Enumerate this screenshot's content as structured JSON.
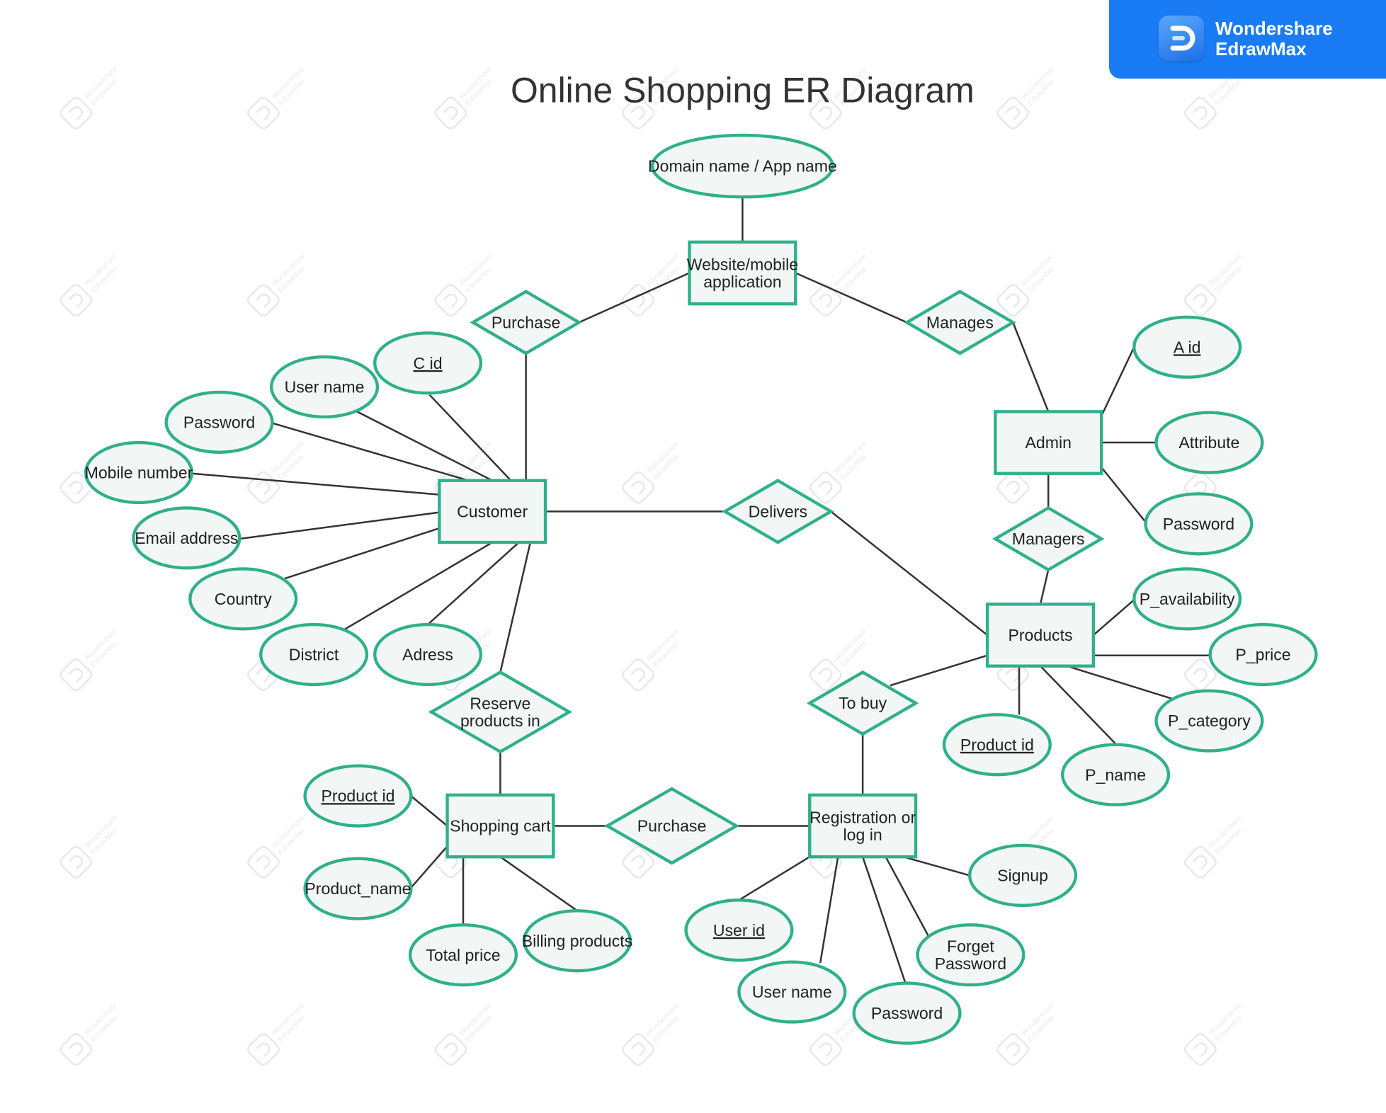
{
  "brand": {
    "name_line1": "Wondershare",
    "name_line2": "EdrawMax",
    "color": "#1a7cf5"
  },
  "title": "Online Shopping ER Diagram",
  "watermark": {
    "text_line1": "Wondershare",
    "text_line2": "EdrawMax"
  },
  "colors": {
    "shape_stroke": "#2fb08b",
    "shape_fill": "#f2f7f5",
    "connector": "#333333",
    "text": "#222222"
  },
  "entities": [
    {
      "id": "website",
      "label": [
        "Website/mobile",
        "application"
      ]
    },
    {
      "id": "customer",
      "label": [
        "Customer"
      ]
    },
    {
      "id": "admin",
      "label": [
        "Admin"
      ]
    },
    {
      "id": "products",
      "label": [
        "Products"
      ]
    },
    {
      "id": "shopping_cart",
      "label": [
        "Shopping cart"
      ]
    },
    {
      "id": "registration",
      "label": [
        "Registration or",
        "log in"
      ]
    }
  ],
  "relationships": [
    {
      "id": "purchase_top",
      "label": [
        "Purchase"
      ]
    },
    {
      "id": "manages",
      "label": [
        "Manages"
      ]
    },
    {
      "id": "delivers",
      "label": [
        "Delivers"
      ]
    },
    {
      "id": "managers",
      "label": [
        "Managers"
      ]
    },
    {
      "id": "reserve",
      "label": [
        "Reserve",
        "products in"
      ]
    },
    {
      "id": "to_buy",
      "label": [
        "To buy"
      ]
    },
    {
      "id": "purchase_bottom",
      "label": [
        "Purchase"
      ]
    }
  ],
  "attributes": [
    {
      "id": "domain_name",
      "label": [
        "Domain name / App name"
      ],
      "key": false,
      "of": "website"
    },
    {
      "id": "c_id",
      "label": [
        "C id"
      ],
      "key": true,
      "of": "customer"
    },
    {
      "id": "cust_user_name",
      "label": [
        "User name"
      ],
      "key": false,
      "of": "customer"
    },
    {
      "id": "cust_password",
      "label": [
        "Password"
      ],
      "key": false,
      "of": "customer"
    },
    {
      "id": "mobile_number",
      "label": [
        "Mobile number"
      ],
      "key": false,
      "of": "customer"
    },
    {
      "id": "email_address",
      "label": [
        "Email address"
      ],
      "key": false,
      "of": "customer"
    },
    {
      "id": "country",
      "label": [
        "Country"
      ],
      "key": false,
      "of": "customer"
    },
    {
      "id": "district",
      "label": [
        "District"
      ],
      "key": false,
      "of": "customer"
    },
    {
      "id": "adress",
      "label": [
        "Adress"
      ],
      "key": false,
      "of": "customer"
    },
    {
      "id": "a_id",
      "label": [
        "A id"
      ],
      "key": true,
      "of": "admin"
    },
    {
      "id": "attribute",
      "label": [
        "Attribute"
      ],
      "key": false,
      "of": "admin"
    },
    {
      "id": "admin_password",
      "label": [
        "Password"
      ],
      "key": false,
      "of": "admin"
    },
    {
      "id": "p_availability",
      "label": [
        "P_availability"
      ],
      "key": false,
      "of": "products"
    },
    {
      "id": "p_price",
      "label": [
        "P_price"
      ],
      "key": false,
      "of": "products"
    },
    {
      "id": "p_category",
      "label": [
        "P_category"
      ],
      "key": false,
      "of": "products"
    },
    {
      "id": "p_name",
      "label": [
        "P_name"
      ],
      "key": false,
      "of": "products"
    },
    {
      "id": "prod_product_id",
      "label": [
        "Product id"
      ],
      "key": true,
      "of": "products"
    },
    {
      "id": "cart_product_id",
      "label": [
        "Product id"
      ],
      "key": true,
      "of": "shopping_cart"
    },
    {
      "id": "cart_product_name",
      "label": [
        "Product_name"
      ],
      "key": false,
      "of": "shopping_cart"
    },
    {
      "id": "total_price",
      "label": [
        "Total price"
      ],
      "key": false,
      "of": "shopping_cart"
    },
    {
      "id": "billing_products",
      "label": [
        "Billing products"
      ],
      "key": false,
      "of": "shopping_cart"
    },
    {
      "id": "user_id",
      "label": [
        "User id"
      ],
      "key": true,
      "of": "registration"
    },
    {
      "id": "reg_user_name",
      "label": [
        "User name"
      ],
      "key": false,
      "of": "registration"
    },
    {
      "id": "reg_password",
      "label": [
        "Password"
      ],
      "key": false,
      "of": "registration"
    },
    {
      "id": "forget_password",
      "label": [
        "Forget",
        "Password"
      ],
      "key": false,
      "of": "registration"
    },
    {
      "id": "signup",
      "label": [
        "Signup"
      ],
      "key": false,
      "of": "registration"
    }
  ],
  "links": [
    [
      "domain_name",
      "website"
    ],
    [
      "website",
      "purchase_top"
    ],
    [
      "website",
      "manages"
    ],
    [
      "purchase_top",
      "customer"
    ],
    [
      "manages",
      "admin"
    ],
    [
      "customer",
      "delivers"
    ],
    [
      "delivers",
      "products"
    ],
    [
      "admin",
      "managers"
    ],
    [
      "managers",
      "products"
    ],
    [
      "customer",
      "reserve"
    ],
    [
      "reserve",
      "shopping_cart"
    ],
    [
      "shopping_cart",
      "purchase_bottom"
    ],
    [
      "purchase_bottom",
      "registration"
    ],
    [
      "registration",
      "to_buy"
    ],
    [
      "to_buy",
      "products"
    ]
  ]
}
